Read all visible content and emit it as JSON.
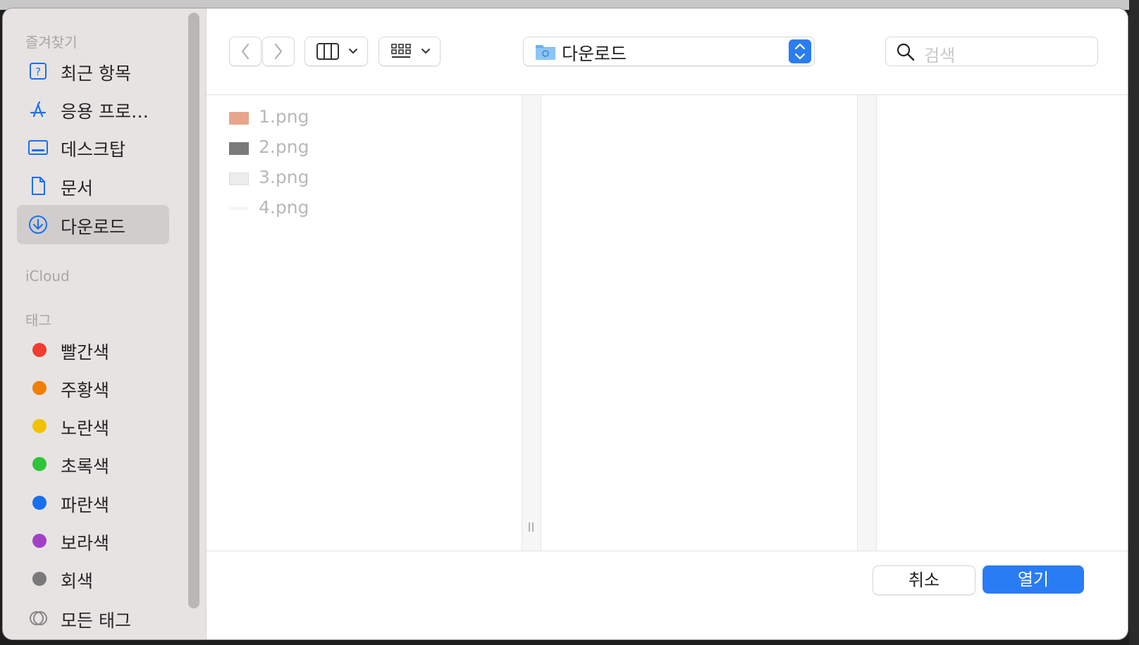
{
  "sidebar": {
    "favorites_header": "즐겨찾기",
    "favorites": [
      {
        "label": "최근 항목",
        "icon": "recent-icon"
      },
      {
        "label": "응용 프로…",
        "icon": "applications-icon"
      },
      {
        "label": "데스크탑",
        "icon": "desktop-icon"
      },
      {
        "label": "문서",
        "icon": "document-icon"
      },
      {
        "label": "다운로드",
        "icon": "downloads-icon",
        "selected": true
      }
    ],
    "icloud_header": "iCloud",
    "tags_header": "태그",
    "tags": [
      {
        "label": "빨간색",
        "color": "#f23b32"
      },
      {
        "label": "주황색",
        "color": "#f0800a"
      },
      {
        "label": "노란색",
        "color": "#f2c100"
      },
      {
        "label": "초록색",
        "color": "#2ec43b"
      },
      {
        "label": "파란색",
        "color": "#1a6ff0"
      },
      {
        "label": "보라색",
        "color": "#a440c8"
      },
      {
        "label": "회색",
        "color": "#7a7a7a"
      },
      {
        "label": "모든 태그",
        "color": "#888888"
      }
    ]
  },
  "toolbar": {
    "back_icon": "chevron-left-icon",
    "forward_icon": "chevron-right-icon",
    "view_mode_icon": "columns-view-icon",
    "group_icon": "grid-icon",
    "current_folder": "다운로드",
    "search_placeholder": "검색"
  },
  "files": [
    {
      "name": "1.png",
      "thumb_color": "#e8a58c"
    },
    {
      "name": "2.png",
      "thumb_color": "#7a7a7a"
    },
    {
      "name": "3.png",
      "thumb_color": "#ececec"
    },
    {
      "name": "4.png",
      "thumb_color": "#dcdcdc"
    }
  ],
  "footer": {
    "cancel_label": "취소",
    "open_label": "열기"
  },
  "colors": {
    "accent": "#2a7cf4",
    "sidebar_bg": "#e7e3e2",
    "selected_bg": "#d1cdcc"
  }
}
